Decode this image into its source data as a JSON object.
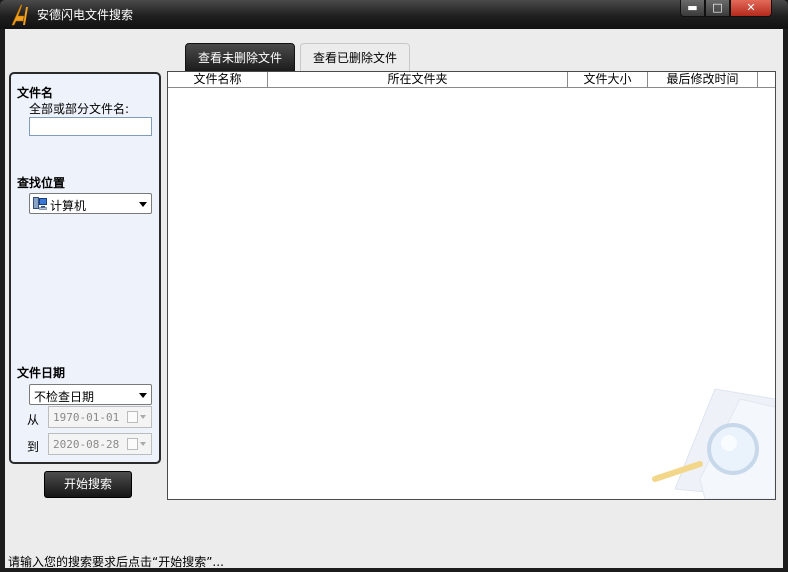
{
  "window": {
    "title": "安德闪电文件搜索",
    "controls": {
      "minimize": "▬",
      "maximize": "□",
      "close": "✕"
    }
  },
  "tabs": [
    {
      "label": "查看未删除文件",
      "active": true
    },
    {
      "label": "查看已删除文件",
      "active": false
    }
  ],
  "sidebar": {
    "filename_section": {
      "title": "文件名",
      "label": "全部或部分文件名:",
      "value": ""
    },
    "location_section": {
      "title": "查找位置",
      "selected": "计算机",
      "icon": "computer-icon"
    },
    "date_section": {
      "title": "文件日期",
      "mode": "不检查日期",
      "from_label": "从",
      "from_value": "1970-01-01",
      "to_label": "到",
      "to_value": "2020-08-28"
    }
  },
  "search_button": "开始搜索",
  "table": {
    "columns": [
      "文件名称",
      "所在文件夹",
      "文件大小",
      "最后修改时间"
    ],
    "rows": []
  },
  "status_bar": "请输入您的搜索要求后点击“开始搜索”..."
}
